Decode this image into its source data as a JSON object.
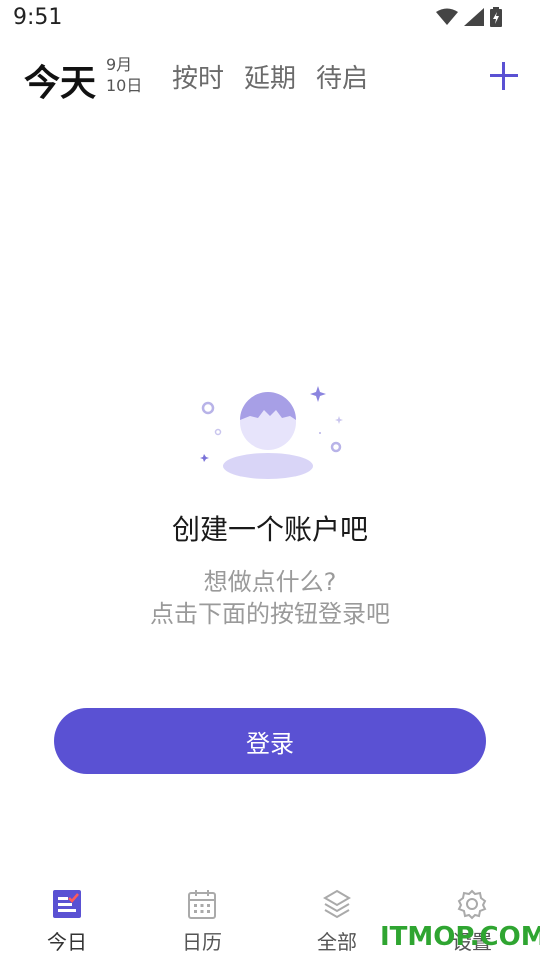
{
  "status_bar": {
    "time": "9:51"
  },
  "header": {
    "title": "今天",
    "month": "9月",
    "day": "10日",
    "tabs": [
      "按时",
      "延期",
      "待启"
    ],
    "accent_color": "#5a51d3"
  },
  "empty_state": {
    "title": "创建一个账户吧",
    "subtitle_line1": "想做点什么?",
    "subtitle_line2": "点击下面的按钮登录吧",
    "illustration_icon": "avatar-placeholder-illustration"
  },
  "login_button": {
    "label": "登录"
  },
  "bottom_nav": {
    "items": [
      {
        "label": "今日",
        "icon": "today-list-icon",
        "active": true
      },
      {
        "label": "日历",
        "icon": "calendar-icon",
        "active": false
      },
      {
        "label": "全部",
        "icon": "layers-icon",
        "active": false
      },
      {
        "label": "设置",
        "icon": "gear-icon",
        "active": false
      }
    ]
  },
  "watermark": {
    "text": "ITMOP.COM"
  }
}
